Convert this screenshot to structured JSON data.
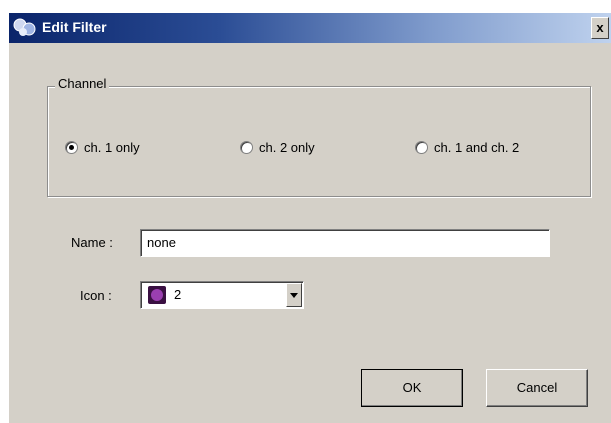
{
  "window": {
    "title": "Edit Filter",
    "app_icon": "app-icon",
    "close_label": "x"
  },
  "channel": {
    "legend": "Channel",
    "options": [
      {
        "label": "ch. 1 only",
        "selected": true
      },
      {
        "label": "ch. 2 only",
        "selected": false
      },
      {
        "label": "ch. 1 and ch. 2",
        "selected": false
      }
    ]
  },
  "name": {
    "label": "Name :",
    "value": "none"
  },
  "icon": {
    "label": "Icon :",
    "selected_value": "2",
    "swatch_color": "#9a3fb0"
  },
  "buttons": {
    "ok": "OK",
    "cancel": "Cancel"
  }
}
